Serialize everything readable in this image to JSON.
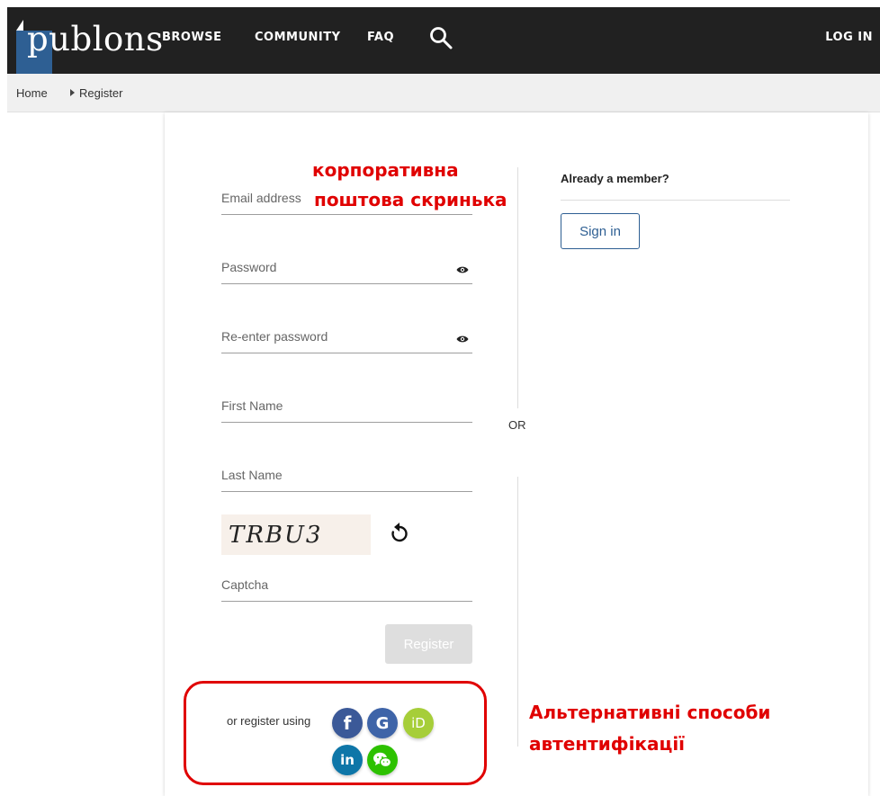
{
  "header": {
    "logo_text": "publons",
    "nav": [
      "BROWSE",
      "COMMUNITY",
      "FAQ"
    ],
    "login": "LOG IN"
  },
  "breadcrumb": {
    "home": "Home",
    "current": "Register"
  },
  "form": {
    "email_label": "Email address",
    "password_label": "Password",
    "reenter_label": "Re-enter password",
    "first_name_label": "First Name",
    "last_name_label": "Last Name",
    "captcha_text": "TRBU3",
    "captcha_label": "Captcha",
    "register_button": "Register"
  },
  "separator": "OR",
  "member": {
    "heading": "Already a member?",
    "signin_button": "Sign in"
  },
  "alt": {
    "label": "or register using",
    "providers": [
      "f",
      "G",
      "iD",
      "in"
    ]
  },
  "annotations": {
    "email_note_line1": "корпоративна",
    "email_note_line2": "поштова скринька",
    "alt_note_line1": "Альтернативні способи",
    "alt_note_line2": "автентифікації"
  },
  "colors": {
    "header_bg": "#212121",
    "logo_blue": "#2e5f93",
    "annotation_red": "#e00000",
    "facebook": "#3b5998",
    "google": "#3e64a8",
    "orcid": "#a6ce39",
    "linkedin": "#0e76a8",
    "wechat": "#2dc100"
  }
}
